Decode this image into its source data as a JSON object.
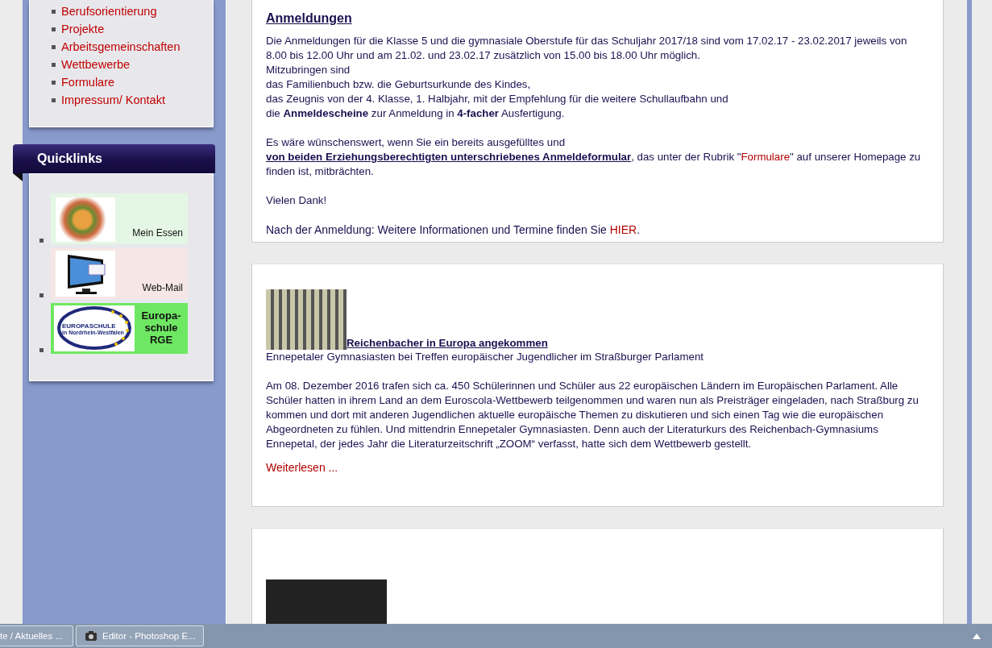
{
  "nav": {
    "items": [
      {
        "label": "Berufsorientierung"
      },
      {
        "label": "Projekte"
      },
      {
        "label": "Arbeitsgemeinschaften"
      },
      {
        "label": "Wettbewerbe"
      },
      {
        "label": "Formulare"
      },
      {
        "label": "Impressum/ Kontakt"
      }
    ]
  },
  "quicklinks": {
    "title": "Quicklinks",
    "items": [
      {
        "kind": "food",
        "label": "Mein Essen"
      },
      {
        "kind": "mail",
        "label": "Web-Mail"
      },
      {
        "kind": "europa",
        "label": "Europa-schule RGE",
        "logo_text": "EUROPASCHULE",
        "logo_subtext": "in Nordrhein-Westfalen"
      }
    ]
  },
  "articles": [
    {
      "kind": "notice",
      "title": "Anmeldungen",
      "lines": [
        "Die Anmeldungen für die Klasse 5 und die gymnasiale Oberstufe für das Schuljahr 2017/18 sind vom 17.02.17 - 23.02.2017 jeweils von 8.00 bis 12.00 Uhr und am 21.02. und 23.02.17 zusätzlich von 15.00 bis 18.00 Uhr möglich.",
        "Mitzubringen sind",
        "das Familienbuch bzw. die Geburtsurkunde des Kindes,",
        "das Zeugnis von der 4. Klasse, 1. Halbjahr, mit der Empfehlung für die weitere Schullaufbahn und",
        "die **Anmeldescheine** zur Anmeldung in **4-facher** Ausfertigung."
      ],
      "request": [
        {
          "kind": "text",
          "text": "Es wäre wünschenswert, wenn Sie ein bereits ausgefülltes und "
        },
        {
          "kind": "strong-link",
          "text": "von beiden Erziehungsberechtigten unterschriebenes Anmeldeformular"
        },
        {
          "kind": "text",
          "text": ", das unter der Rubrik \""
        },
        {
          "kind": "link",
          "text": "Formulare"
        },
        {
          "kind": "text",
          "text": "\" auf unserer Homepage zu finden ist, mitbrächten."
        }
      ],
      "thanks": "Vielen Dank!",
      "footer": [
        {
          "kind": "text",
          "text": "Nach der Anmeldung: Weitere Informationen und Termine finden Sie "
        },
        {
          "kind": "link",
          "text": "HIER"
        },
        {
          "kind": "text",
          "text": "."
        }
      ]
    },
    {
      "kind": "news",
      "title": "Reichenbacher in Europa angekommen",
      "subtitle": "Ennepetaler Gymnasiasten bei Treffen europäischer Jugendlicher im Straßburger Parlament",
      "body": "Am 08. Dezember 2016 trafen sich ca. 450 Schülerinnen und Schüler aus 22 europäischen Ländern im Europäischen Parlament. Alle Schüler hatten in ihrem Land an dem Euroscola-Wettbewerb teilgenommen und waren nun als Preisträger eingeladen, nach Straßburg zu kommen und dort mit anderen Jugendlichen aktuelle europäische Themen zu diskutieren und sich einen Tag wie die europäischen Abgeordneten zu fühlen. Und mittendrin Ennepetaler Gymnasiasten. Denn auch der Literaturkurs des Reichenbach-Gymnasiums Ennepetal, der jedes Jahr die Literaturzeitschrift „ZOOM“ verfasst, hatte sich dem Wettbewerb gestellt.",
      "more": "Weiterlesen ..."
    },
    {
      "kind": "photo"
    }
  ],
  "taskbar": {
    "items": [
      {
        "label": "te / Aktuelles ...",
        "kind": "plain"
      },
      {
        "label": "Editor - Photoshop E...",
        "kind": "app"
      }
    ]
  }
}
